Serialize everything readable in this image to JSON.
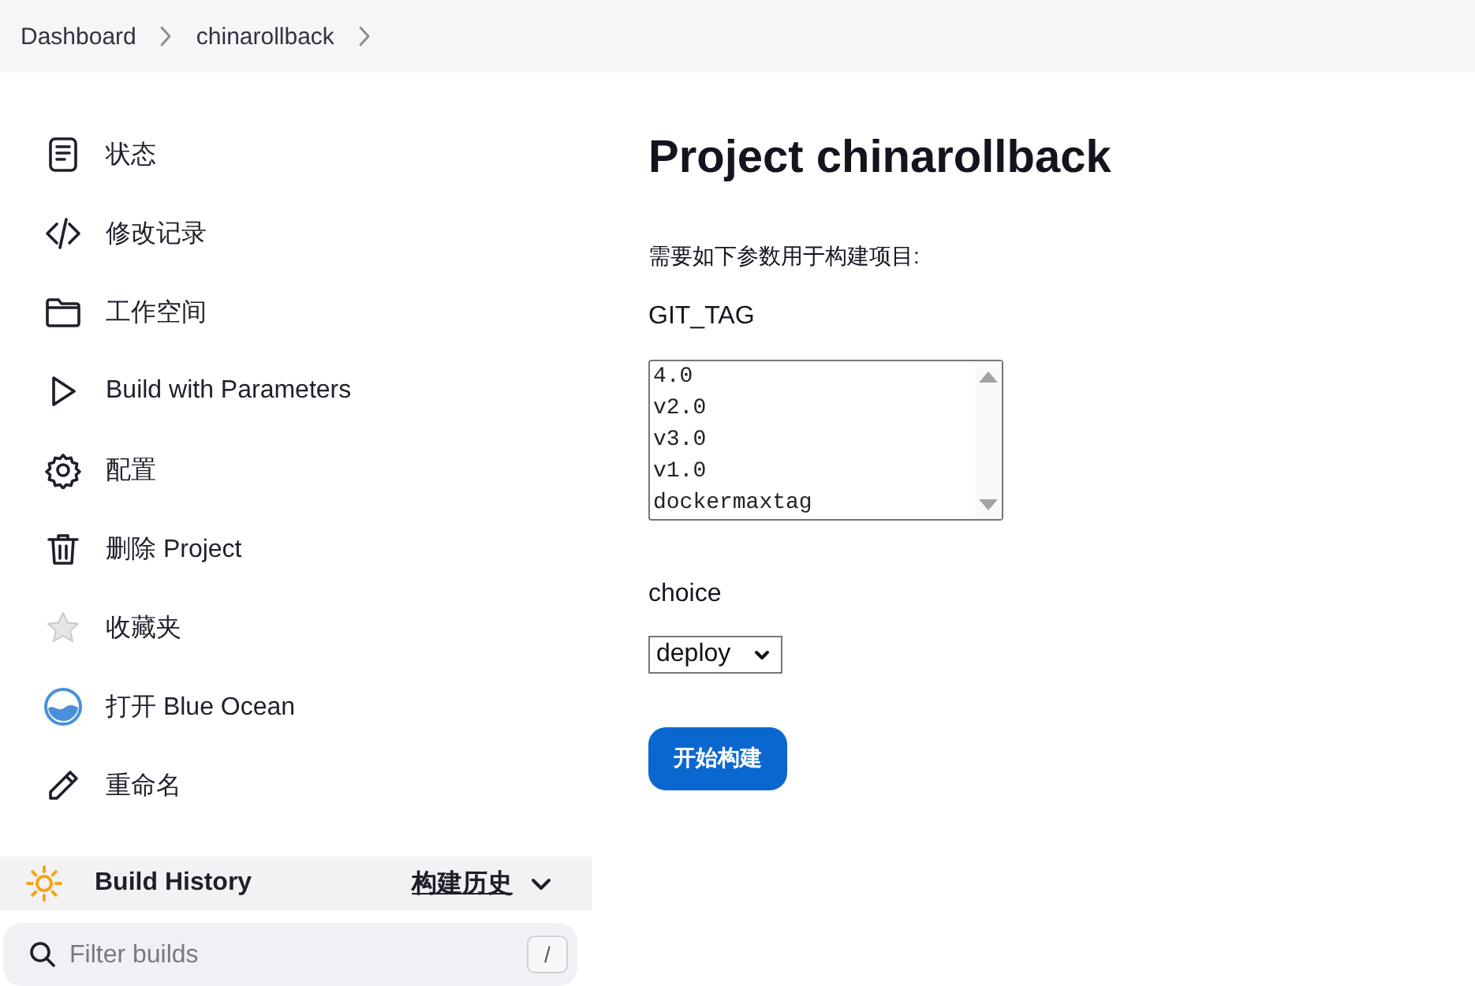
{
  "breadcrumb": [
    {
      "label": "Dashboard"
    },
    {
      "label": "chinarollback"
    }
  ],
  "sidebar": {
    "items": [
      {
        "label": "状态"
      },
      {
        "label": "修改记录"
      },
      {
        "label": "工作空间"
      },
      {
        "label": "Build with Parameters"
      },
      {
        "label": "配置"
      },
      {
        "label": "删除 Project"
      },
      {
        "label": "收藏夹"
      },
      {
        "label": "打开 Blue Ocean"
      },
      {
        "label": "重命名"
      }
    ],
    "build_history": {
      "title": "Build History",
      "link": "构建历史"
    },
    "filter": {
      "placeholder": "Filter builds",
      "shortcut": "/"
    }
  },
  "main": {
    "title": "Project chinarollback",
    "description": "需要如下参数用于构建项目:",
    "parameters": [
      {
        "kind": "listbox",
        "name": "GIT_TAG",
        "options": [
          {
            "label": "4.0",
            "selected": false
          },
          {
            "label": "v2.0",
            "selected": false
          },
          {
            "label": "v3.0",
            "selected": false
          },
          {
            "label": "v1.0",
            "selected": false
          },
          {
            "label": "dockermaxtag",
            "selected": false
          }
        ]
      },
      {
        "kind": "dropdown",
        "name": "choice",
        "value": "deploy"
      }
    ],
    "submit_button": "开始构建"
  }
}
